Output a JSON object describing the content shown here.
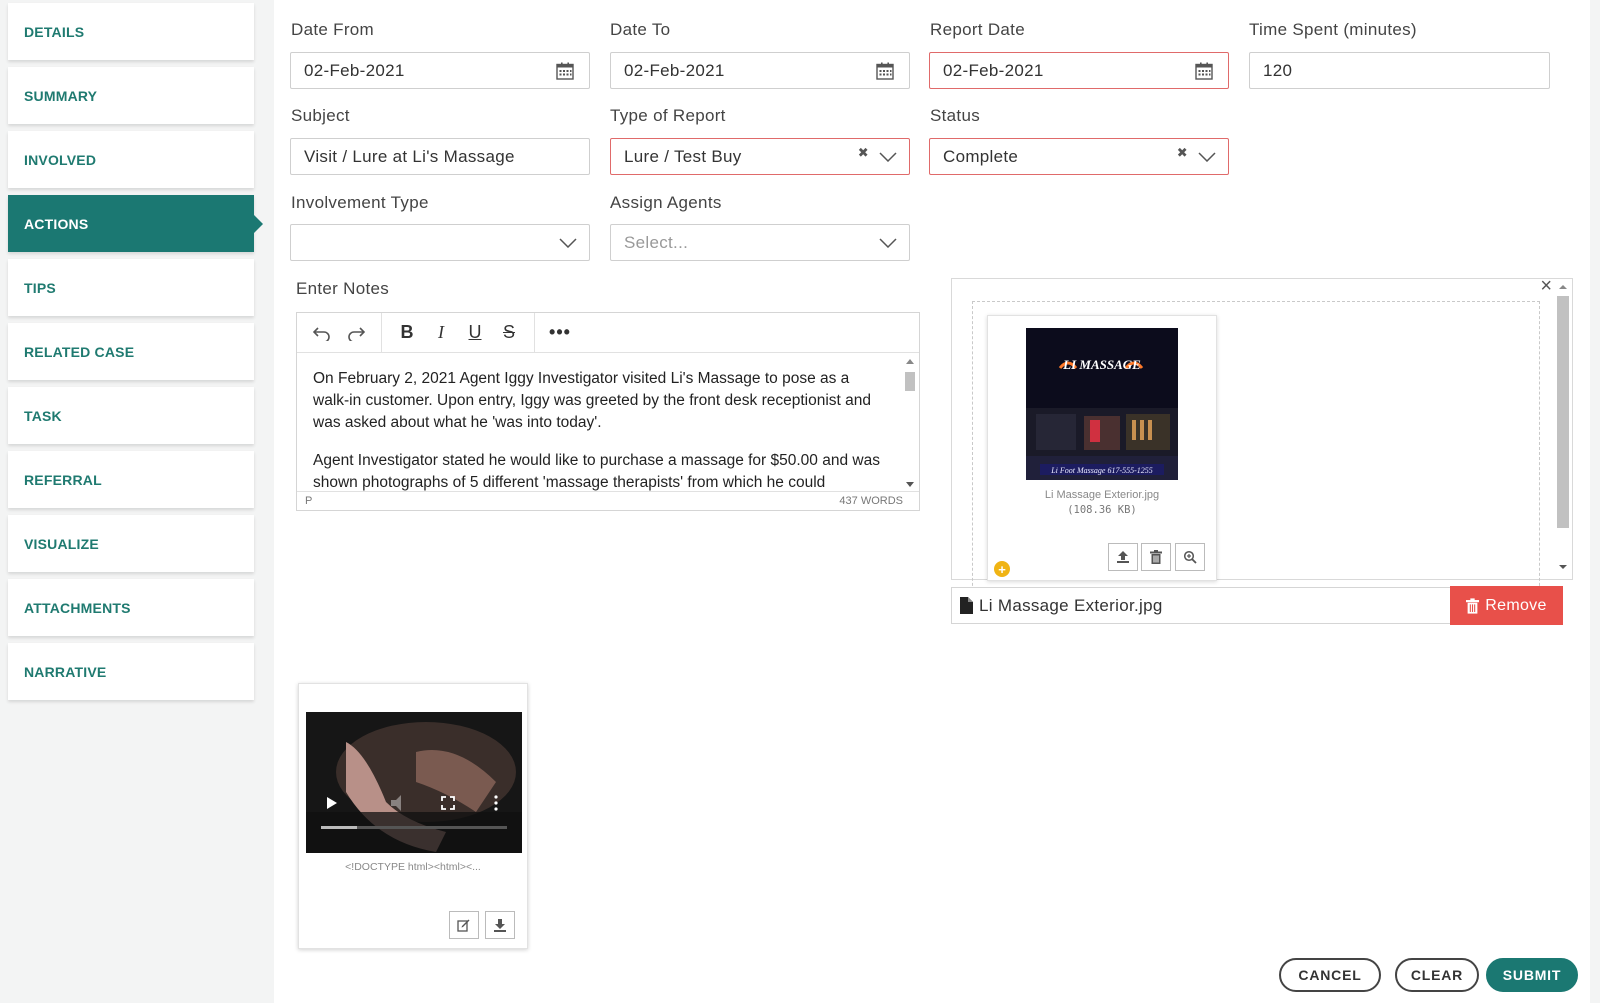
{
  "sidebar": {
    "items": [
      {
        "label": "DETAILS"
      },
      {
        "label": "SUMMARY"
      },
      {
        "label": "INVOLVED"
      },
      {
        "label": "ACTIONS"
      },
      {
        "label": "TIPS"
      },
      {
        "label": "RELATED CASE"
      },
      {
        "label": "TASK"
      },
      {
        "label": "REFERRAL"
      },
      {
        "label": "VISUALIZE"
      },
      {
        "label": "ATTACHMENTS"
      },
      {
        "label": "NARRATIVE"
      }
    ],
    "active_label": "ACTIONS"
  },
  "form": {
    "date_from": {
      "label": "Date From",
      "value": "02-Feb-2021"
    },
    "date_to": {
      "label": "Date To",
      "value": "02-Feb-2021"
    },
    "report_date": {
      "label": "Report Date",
      "value": "02-Feb-2021"
    },
    "time_spent": {
      "label": "Time Spent (minutes)",
      "value": "120"
    },
    "subject": {
      "label": "Subject",
      "value": "Visit / Lure at Li's Massage"
    },
    "type_of_report": {
      "label": "Type of Report",
      "value": "Lure / Test Buy"
    },
    "status": {
      "label": "Status",
      "value": "Complete"
    },
    "involvement_type": {
      "label": "Involvement Type",
      "value": ""
    },
    "assign_agents": {
      "label": "Assign Agents",
      "placeholder": "Select..."
    }
  },
  "notes": {
    "label": "Enter Notes",
    "paragraphs": [
      "On February 2, 2021 Agent Iggy Investigator visited Li's Massage to pose as a walk-in customer. Upon entry, Iggy was greeted by the front desk receptionist and was asked about what he 'was into today'.",
      "Agent Investigator stated he would like to purchase a massage for $50.00 and was shown photographs of 5 different 'massage therapists' from which he could"
    ],
    "path_indicator": "P",
    "word_count": "437 WORDS"
  },
  "upload": {
    "thumb_sign_text": "LI MASSAGE",
    "thumb_caption": "Li Foot Massage 617-555-1255",
    "file_name": "Li Massage Exterior.jpg",
    "file_size": "(108.36 KB)",
    "plus_glyph": "+",
    "close_glyph": "×",
    "remove_label": "Remove"
  },
  "video": {
    "caption": "<!DOCTYPE html><html><..."
  },
  "footer": {
    "cancel_label": "CANCEL",
    "clear_label": "CLEAR",
    "submit_label": "SUBMIT"
  },
  "colors": {
    "accent": "#1b7872",
    "required_border": "#e06a6a",
    "remove": "#e8504a",
    "badge": "#f0b414"
  }
}
